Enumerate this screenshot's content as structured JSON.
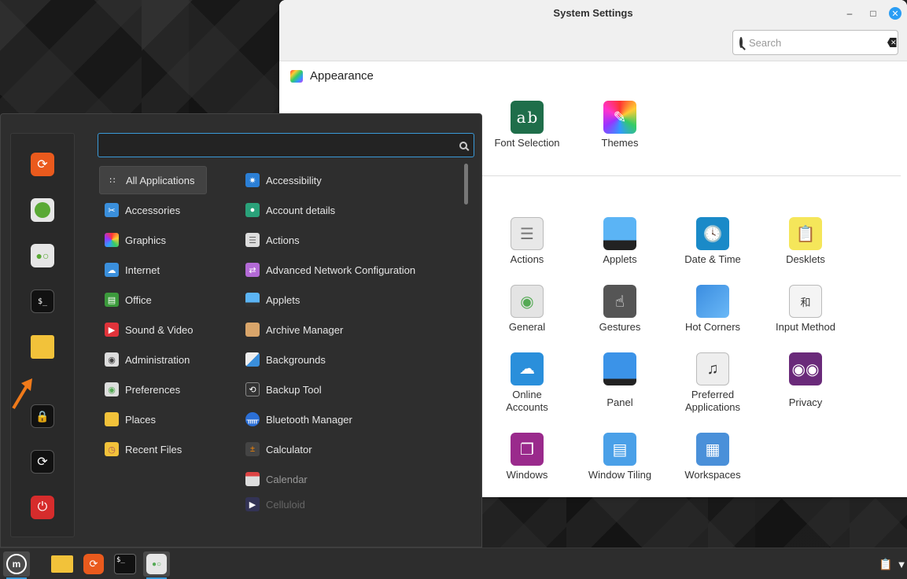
{
  "settings": {
    "title": "System Settings",
    "search_placeholder": "Search",
    "section_appearance": "Appearance",
    "appearance_items": [
      "Font Selection",
      "Themes"
    ],
    "prefs_items": [
      [
        "Actions",
        "Applets",
        "Date & Time",
        "Desklets"
      ],
      [
        "General",
        "Gestures",
        "Hot Corners",
        "Input Method"
      ],
      [
        "Online\nAccounts",
        "Panel",
        "Preferred\nApplications",
        "Privacy"
      ],
      [
        "Windows",
        "Window Tiling",
        "Workspaces"
      ]
    ]
  },
  "menu": {
    "search_value": "",
    "categories": [
      "All Applications",
      "Accessories",
      "Graphics",
      "Internet",
      "Office",
      "Sound & Video",
      "Administration",
      "Preferences",
      "Places",
      "Recent Files"
    ],
    "apps": [
      "Accessibility",
      "Account details",
      "Actions",
      "Advanced Network Configuration",
      "Applets",
      "Archive Manager",
      "Backgrounds",
      "Backup Tool",
      "Bluetooth Manager",
      "Calculator",
      "Calendar",
      "Celluloid"
    ],
    "favorites": [
      "firefox-icon",
      "software-manager-icon",
      "system-settings-icon",
      "terminal-icon",
      "files-icon"
    ],
    "session": [
      "lock-icon",
      "logout-icon",
      "power-icon"
    ]
  },
  "taskbar": {
    "items": [
      "mint-menu-icon",
      "files-icon",
      "firefox-icon",
      "terminal-icon",
      "system-settings-icon"
    ],
    "tray": [
      "clipboard-icon",
      "network-icon"
    ]
  },
  "colors": {
    "accent": "#3a9ad9",
    "close": "#2a9df4",
    "annotation_arrow": "#f07a1a"
  }
}
